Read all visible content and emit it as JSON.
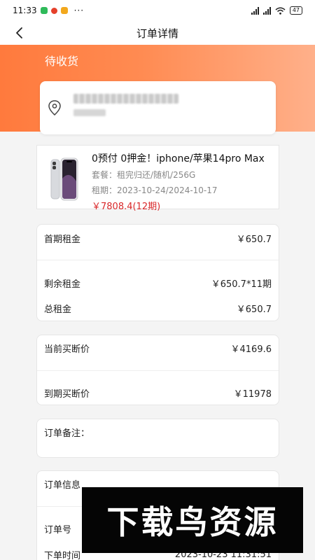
{
  "status_bar": {
    "time": "11:33",
    "more": "···",
    "battery": "47",
    "left_icon_colors": [
      "#2fba5a",
      "#e5402b",
      "#f2a81d"
    ]
  },
  "header": {
    "title": "订单详情",
    "back_icon": "chevron-left-icon"
  },
  "order_status": "待收货",
  "address": {
    "name_phone": "*******",
    "detail": "****",
    "icon": "location-pin-icon"
  },
  "product": {
    "title": "0预付 0押金！iphone/苹果14pro Max",
    "package_label": "套餐：",
    "package_value": "租完归还/随机/256G",
    "term_label": "租期：",
    "term_value": "2023-10-24/2024-10-17",
    "price": "￥7808.4(12期)",
    "image": "iphone-product-image"
  },
  "rent_card": {
    "first_label": "首期租金",
    "first_value": "￥650.7",
    "remaining_label": "剩余租金",
    "remaining_value": "￥650.7*11期",
    "total_label": "总租金",
    "total_value": "￥650.7"
  },
  "buyout_card": {
    "current_label": "当前买断价",
    "current_value": "￥4169.6",
    "expiry_label": "到期买断价",
    "expiry_value": "￥11978"
  },
  "remark_card": {
    "label": "订单备注："
  },
  "order_info_card": {
    "title": "订单信息",
    "number_label": "订单号",
    "time_label": "下单时间",
    "time_value": "2023-10-23 11:31:51"
  },
  "watermark": {
    "text": "下载鸟资源"
  },
  "colors": {
    "accent_orange": "#ff7a3d",
    "price_red": "#d9282a"
  }
}
